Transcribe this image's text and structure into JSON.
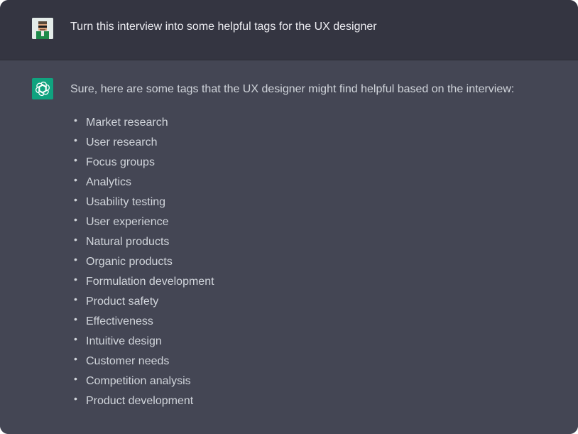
{
  "conversation": {
    "user_message": "Turn this interview into some helpful tags for the UX designer",
    "assistant_intro": "Sure, here are some tags that the UX designer might find helpful based on the interview:",
    "tags": [
      "Market research",
      "User research",
      "Focus groups",
      "Analytics",
      "Usability testing",
      "User experience",
      "Natural products",
      "Organic products",
      "Formulation development",
      "Product safety",
      "Effectiveness",
      "Intuitive design",
      "Customer needs",
      "Competition analysis",
      "Product development"
    ]
  },
  "avatars": {
    "user_icon": "pixel-user-avatar-icon",
    "assistant_icon": "openai-logo-icon"
  },
  "colors": {
    "user_row_bg": "#343541",
    "assistant_row_bg": "#444654",
    "assistant_avatar_bg": "#10a37f",
    "text_primary": "#ececf1",
    "text_secondary": "#d1d5db"
  }
}
